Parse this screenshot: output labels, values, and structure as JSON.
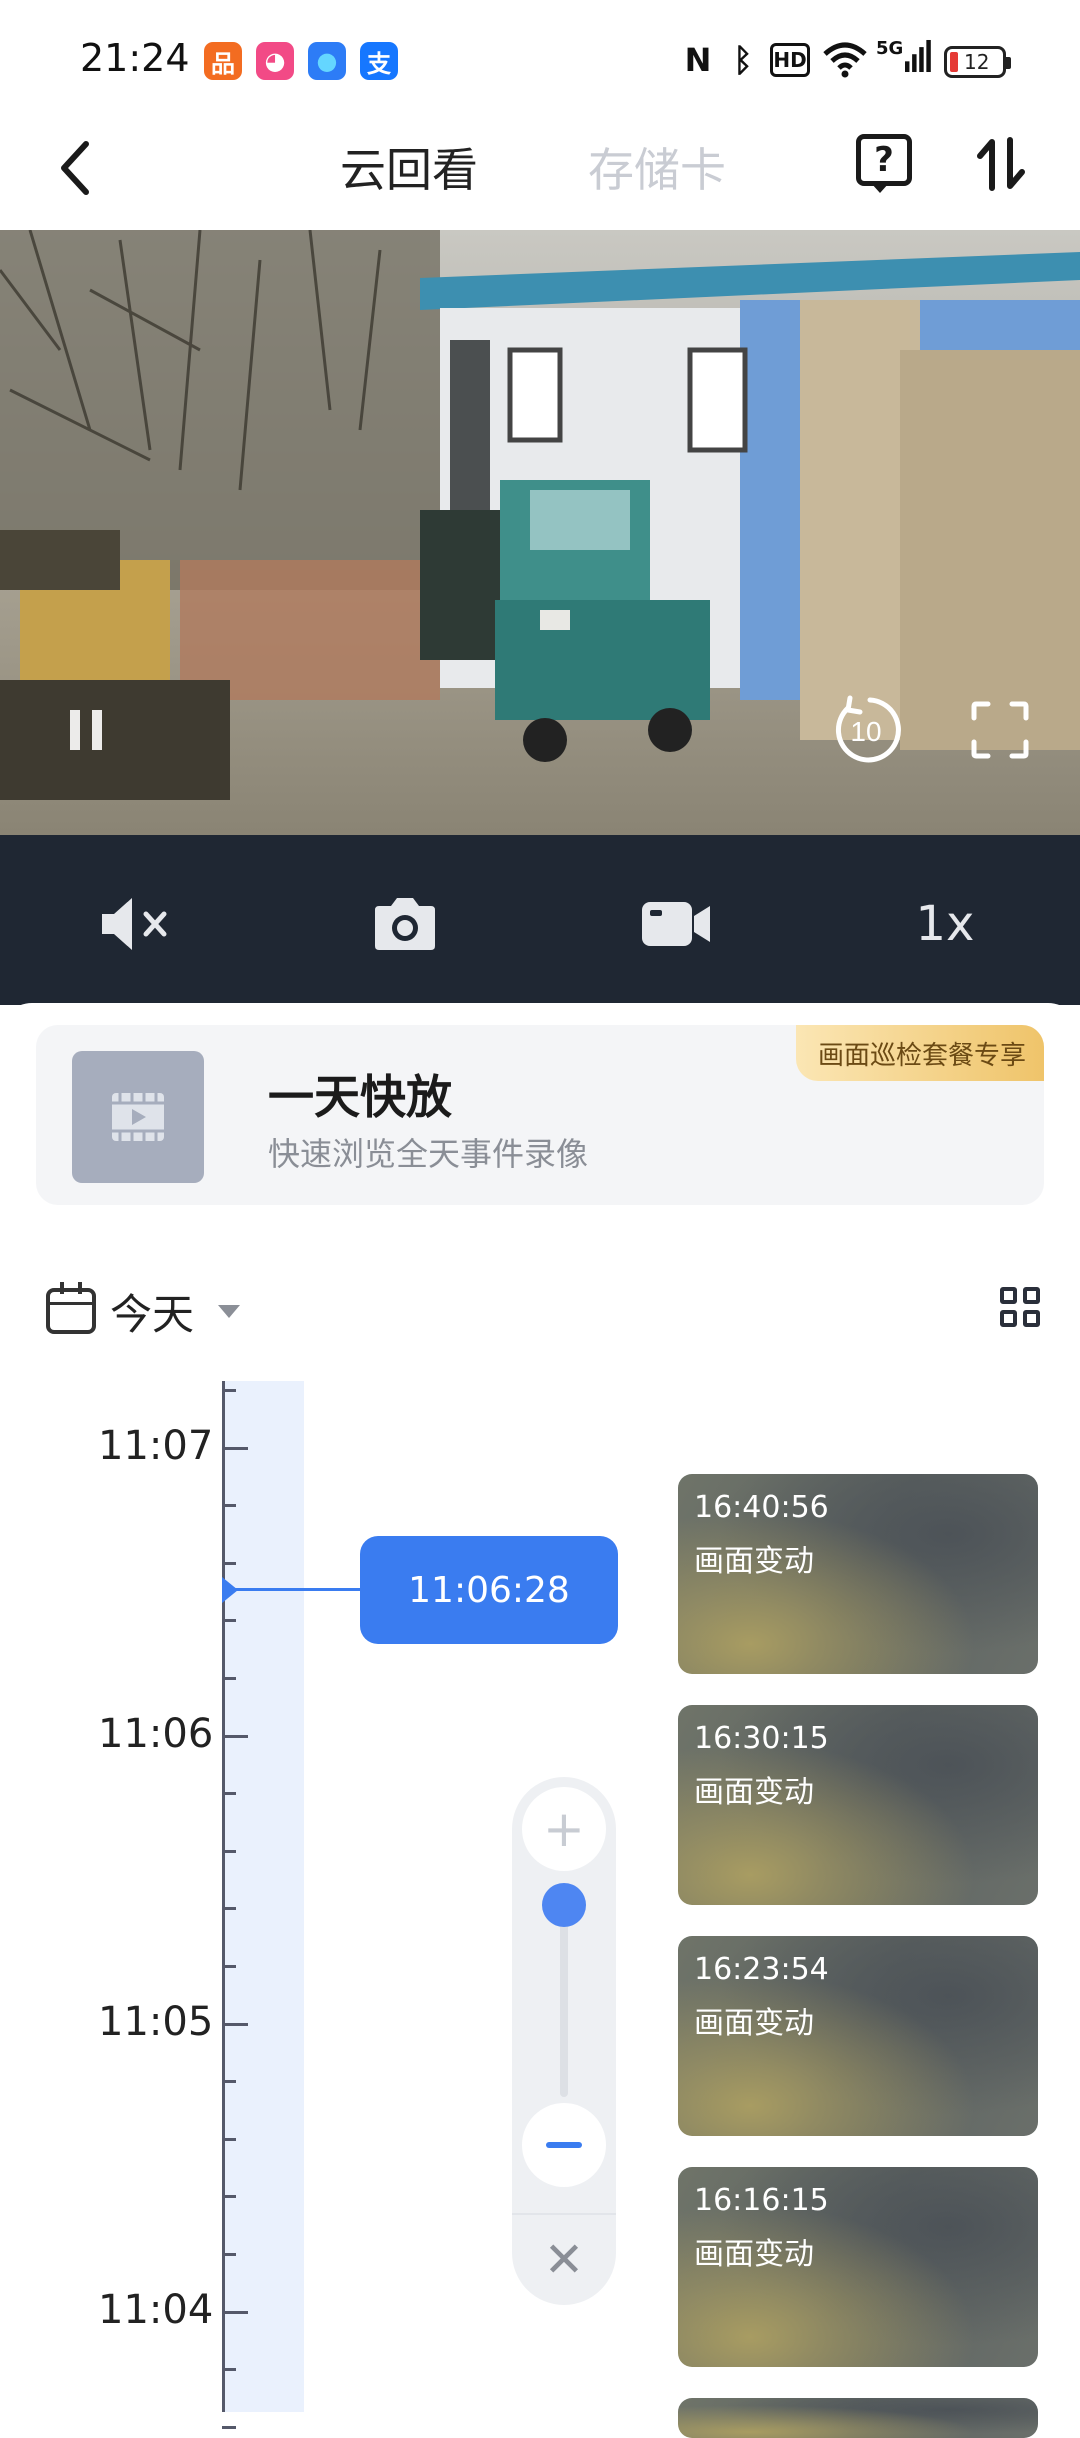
{
  "status_bar": {
    "time": "21:24",
    "apps": [
      {
        "icon": "app-orange-icon",
        "color": "#f36c21",
        "glyph": "品"
      },
      {
        "icon": "app-pink-icon",
        "color": "#f24a86",
        "glyph": "◕"
      },
      {
        "icon": "app-blue-drop-icon",
        "color": "#2d7cf6",
        "glyph": "●"
      },
      {
        "icon": "alipay-icon",
        "color": "#1677ff",
        "glyph": "支"
      }
    ],
    "indicators": [
      "N",
      "ᛒ",
      "HD",
      "5G"
    ],
    "battery_level": "12"
  },
  "nav": {
    "tab_active": "云回看",
    "tab_inactive": "存储卡",
    "help_glyph": "?"
  },
  "player": {
    "speed": "1x",
    "rewind_seconds": "10"
  },
  "quick_play": {
    "title": "一天快放",
    "subtitle": "快速浏览全天事件录像",
    "badge": "画面巡检套餐专享"
  },
  "date_filter": {
    "label": "今天"
  },
  "timeline": {
    "time_labels": [
      "11:07",
      "11:06",
      "11:05",
      "11:04"
    ],
    "cursor_time": "11:06:28"
  },
  "events": [
    {
      "time": "16:40:56",
      "desc": "画面变动"
    },
    {
      "time": "16:30:15",
      "desc": "画面变动"
    },
    {
      "time": "16:23:54",
      "desc": "画面变动"
    },
    {
      "time": "16:16:15",
      "desc": "画面变动"
    }
  ],
  "zoom": {
    "plus": "+",
    "close": "✕"
  },
  "colors": {
    "accent": "#3a7cf0",
    "control_bar": "#1f2733",
    "badge_text": "#6b4a14"
  }
}
